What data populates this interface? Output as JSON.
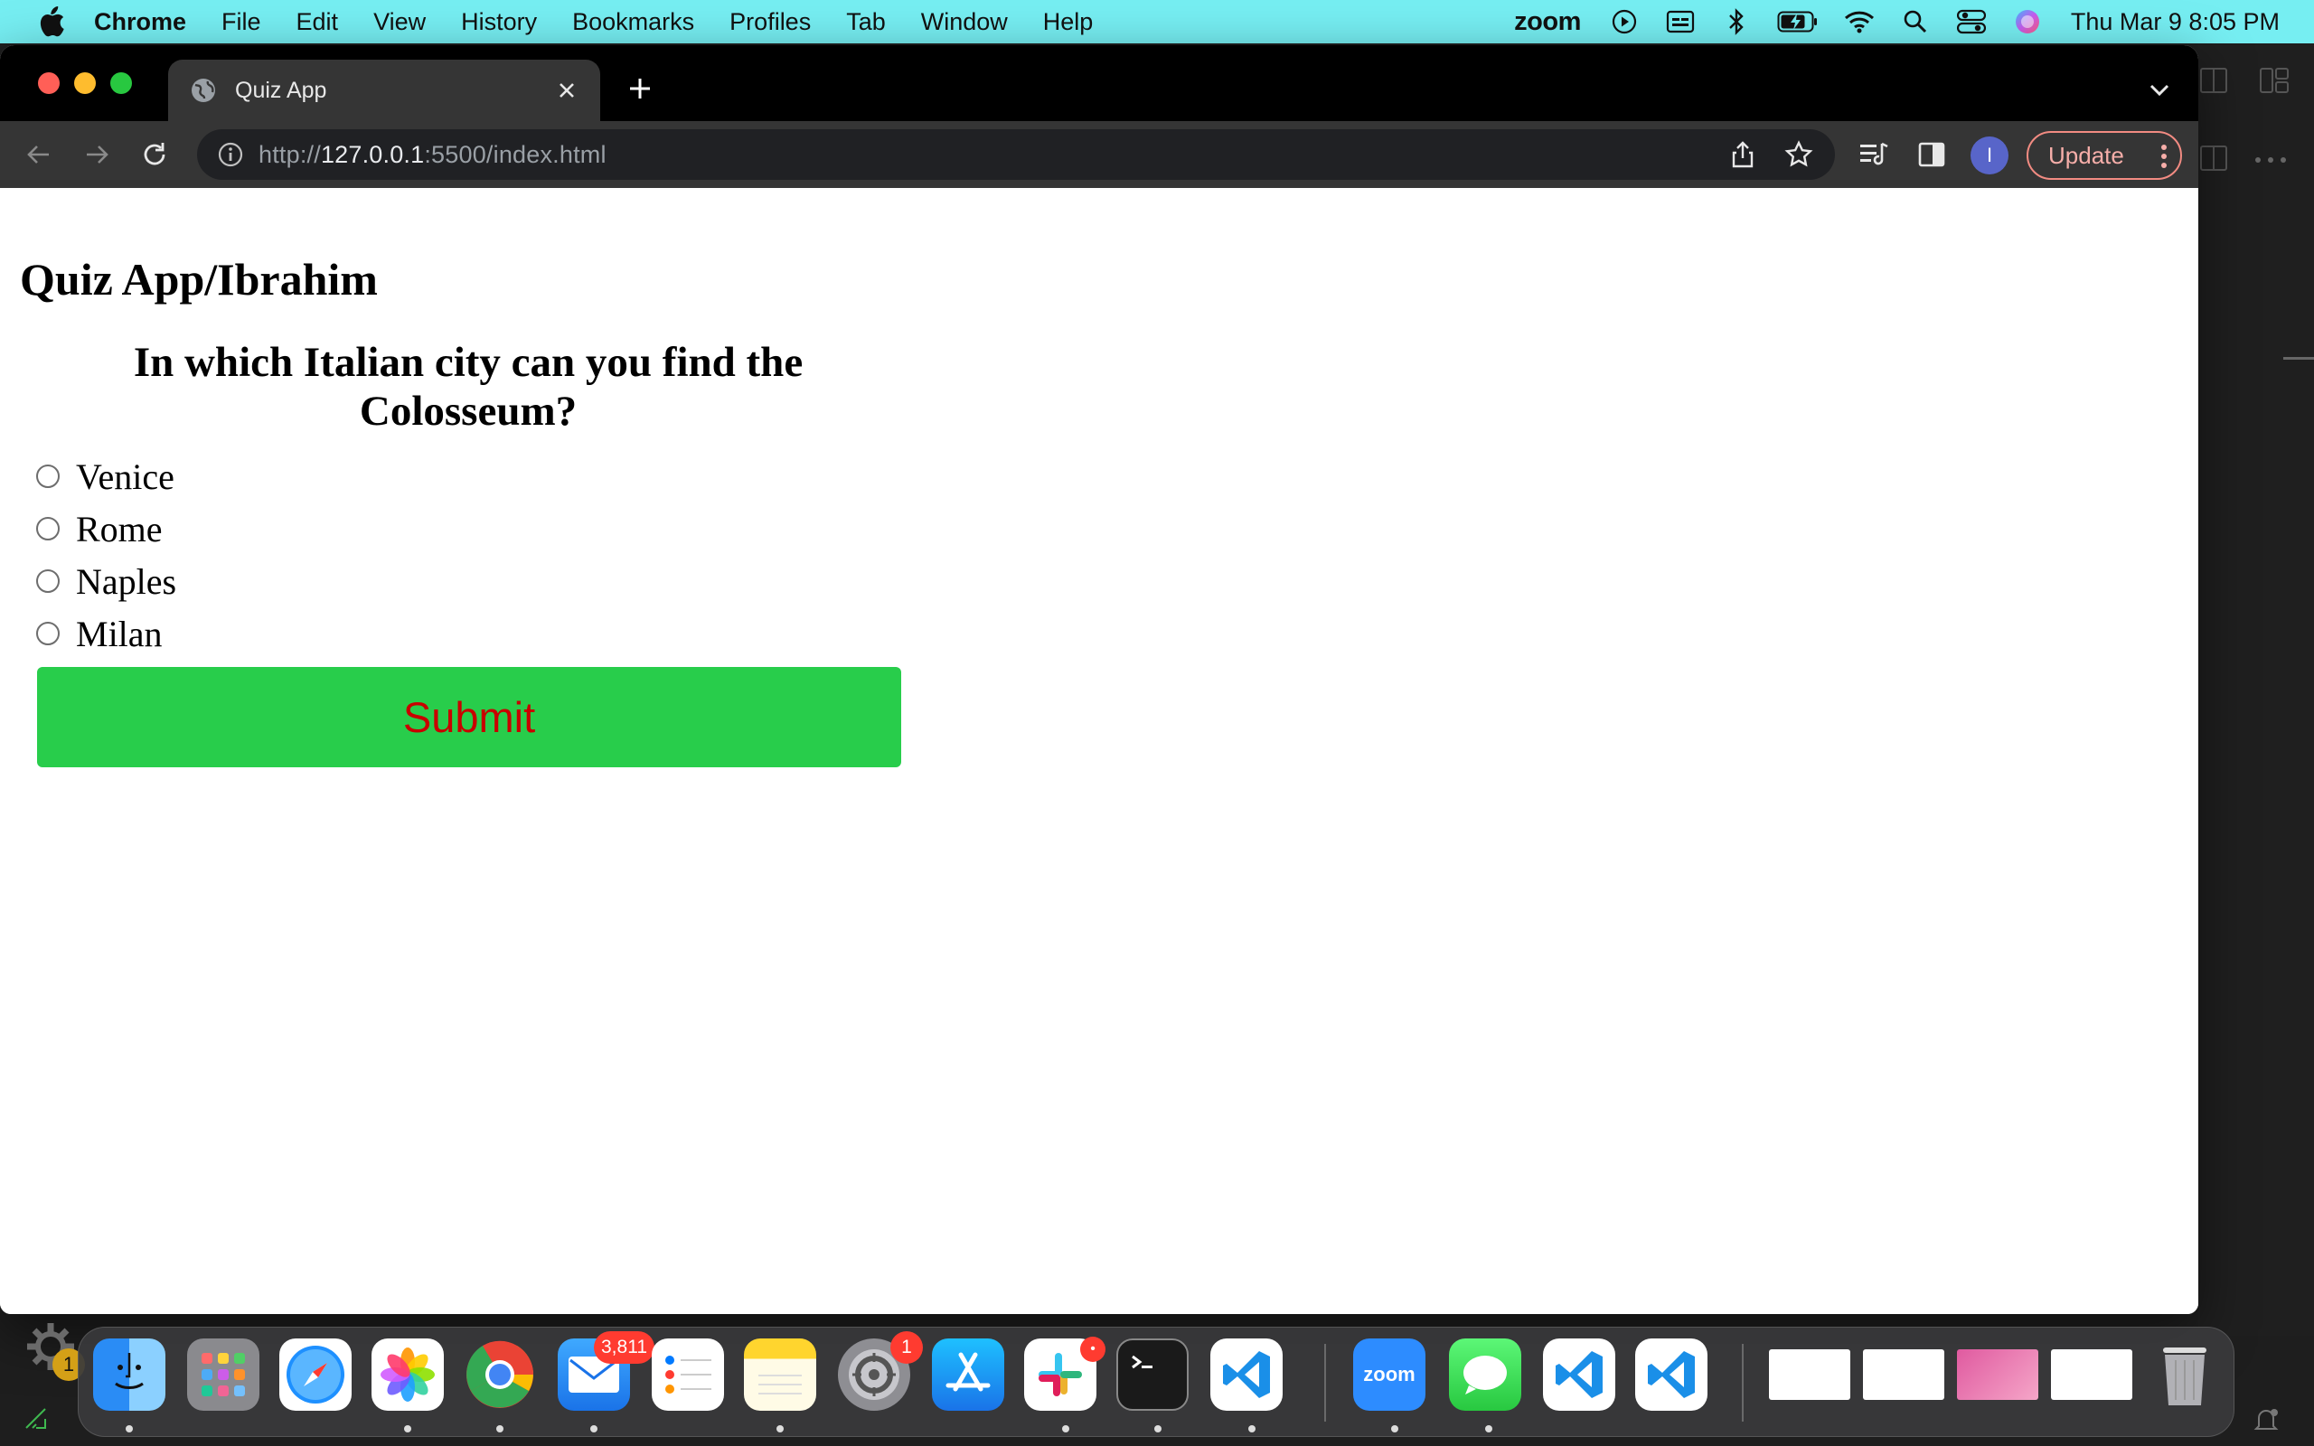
{
  "menubar": {
    "app_name": "Chrome",
    "menus": [
      "File",
      "Edit",
      "View",
      "History",
      "Bookmarks",
      "Profiles",
      "Tab",
      "Window",
      "Help"
    ],
    "zoom_label": "zoom",
    "clock": "Thu Mar 9  8:05 PM"
  },
  "browser": {
    "tab_title": "Quiz App",
    "url_prefix": "http://",
    "url_host": "127.0.0.1",
    "url_suffix": ":5500/index.html",
    "profile_initial": "I",
    "update_label": "Update"
  },
  "page": {
    "title": "Quiz App/Ibrahim",
    "question": "In which Italian city can you find the Colosseum?",
    "options": [
      "Venice",
      "Rome",
      "Naples",
      "Milan"
    ],
    "submit_label": "Submit",
    "submit_bg": "#28cd4b",
    "submit_text_color": "#c90000"
  },
  "dock": {
    "mail_badge": "3,811",
    "settings_badge": "1",
    "left_gear_badge": "1",
    "zoom_label": "zoom"
  },
  "colors": {
    "menubar_bg": "#76eef2",
    "update_border": "#f28b82"
  }
}
